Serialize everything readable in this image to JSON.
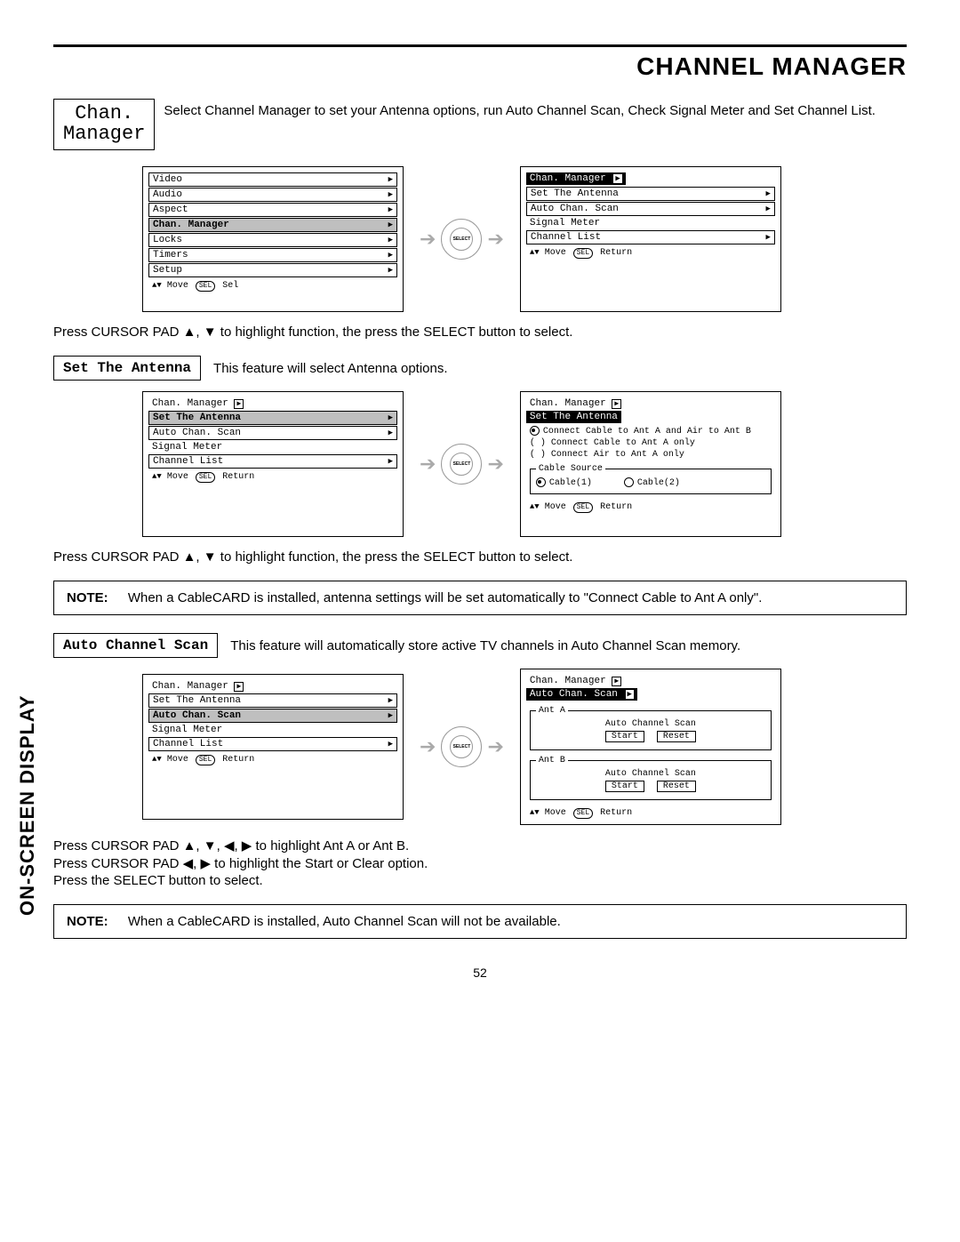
{
  "page": {
    "title": "CHANNEL MANAGER",
    "side_label_light": "ON-SCREEN",
    "side_label_heavy": "DISPLAY",
    "page_number": "52"
  },
  "chan_manager": {
    "tag_line1": "Chan.",
    "tag_line2": "Manager",
    "intro": "Select Channel Manager to set your Antenna options, run Auto Channel Scan, Check Signal Meter and Set Channel List.",
    "instr": "Press CURSOR PAD ▲, ▼ to highlight function, the press the SELECT button to select.",
    "menu_left": {
      "items": [
        "Video",
        "Audio",
        "Aspect",
        "Chan. Manager",
        "Locks",
        "Timers",
        "Setup"
      ],
      "highlight_index": 3,
      "footer_move": "Move",
      "footer_sel": "Sel"
    },
    "menu_right": {
      "title": "Chan. Manager",
      "items": [
        "Set The Antenna",
        "Auto Chan. Scan",
        "Signal Meter",
        "Channel List"
      ],
      "footer_move": "Move",
      "footer_return": "Return"
    }
  },
  "set_antenna": {
    "tag": "Set The Antenna",
    "desc": "This feature will select Antenna options.",
    "instr": "Press CURSOR PAD ▲, ▼ to highlight function, the press the SELECT button to select.",
    "menu_left": {
      "title": "Chan. Manager",
      "items": [
        "Set The Antenna",
        "Auto Chan. Scan",
        "Signal Meter",
        "Channel List"
      ],
      "highlight_index": 0,
      "footer_move": "Move",
      "footer_return": "Return"
    },
    "menu_right": {
      "title": "Chan. Manager",
      "sub_hl": "Set The Antenna",
      "opt1": "Connect Cable to Ant A and Air to Ant B",
      "opt2": "Connect Cable to Ant A only",
      "opt3": "Connect Air to Ant A only",
      "cable_source_legend": "Cable Source",
      "cable1": "Cable(1)",
      "cable2": "Cable(2)",
      "footer_move": "Move",
      "footer_return": "Return"
    },
    "note": "When a CableCARD is installed, antenna settings will be set automatically to \"Connect Cable to Ant A only\"."
  },
  "auto_scan": {
    "tag": "Auto Channel Scan",
    "desc": "This feature will automatically store active TV channels in Auto Channel Scan memory.",
    "menu_left": {
      "title": "Chan. Manager",
      "items": [
        "Set The Antenna",
        "Auto Chan. Scan",
        "Signal Meter",
        "Channel List"
      ],
      "highlight_index": 1,
      "footer_move": "Move",
      "footer_return": "Return"
    },
    "menu_right": {
      "title": "Chan. Manager",
      "sub_hl": "Auto Chan. Scan",
      "antA_legend": "Ant A",
      "antB_legend": "Ant B",
      "scan_label": "Auto Channel Scan",
      "start": "Start",
      "reset": "Reset",
      "footer_move": "Move",
      "footer_return": "Return"
    },
    "instr1": "Press CURSOR PAD ▲, ▼, ◀, ▶ to highlight Ant A or Ant B.",
    "instr2": "Press CURSOR PAD ◀, ▶ to highlight the Start or Clear option.",
    "instr3": "Press the SELECT button to select.",
    "note": "When a CableCARD is installed, Auto Channel Scan will not be available."
  },
  "common": {
    "note_label": "NOTE:",
    "select_center": "SELECT",
    "sel_badge": "SEL",
    "updown": "▲▼",
    "tri_right": "▶"
  }
}
